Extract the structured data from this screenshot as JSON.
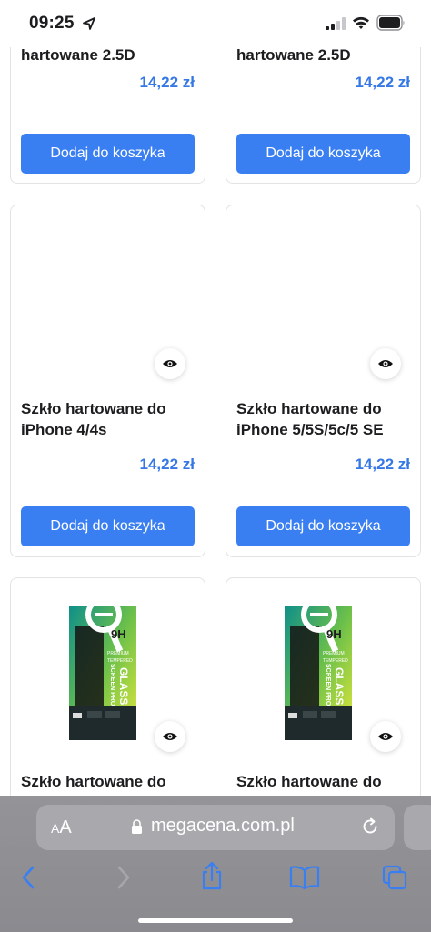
{
  "status_bar": {
    "time": "09:25"
  },
  "products": [
    {
      "title": "hartowane 2.5D",
      "price": "14,22 zł",
      "button": "Dodaj do koszyka",
      "image": "none"
    },
    {
      "title": "hartowane 2.5D",
      "price": "14,22 zł",
      "button": "Dodaj do koszyka",
      "image": "none"
    },
    {
      "title": "Szkło hartowane do iPhone 4/4s",
      "price": "14,22 zł",
      "button": "Dodaj do koszyka",
      "image": "blank"
    },
    {
      "title": "Szkło hartowane do iPhone 5/5S/5c/5 SE",
      "price": "14,22 zł",
      "button": "Dodaj do koszyka",
      "image": "blank"
    },
    {
      "title": "Szkło hartowane do",
      "price": "",
      "button": "",
      "image": "glass-box"
    },
    {
      "title": "Szkło hartowane do",
      "price": "",
      "button": "",
      "image": "glass-box"
    }
  ],
  "package_art": {
    "badge": "9H",
    "line1": "PREMIUM",
    "line2": "TEMPERED",
    "line3": "GLASS",
    "line4": "SCREEN PRO"
  },
  "browser": {
    "aa_label_small": "A",
    "aa_label_large": "A",
    "url": "megacena.com.pl"
  },
  "colors": {
    "accent": "#3a7ff2",
    "price": "#3578e5"
  }
}
